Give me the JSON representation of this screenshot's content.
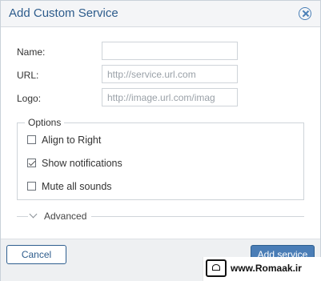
{
  "dialog": {
    "title": "Add Custom Service",
    "close_icon": "close-circle-icon"
  },
  "form": {
    "name_label": "Name:",
    "name_value": "",
    "name_placeholder": "",
    "url_label": "URL:",
    "url_value": "",
    "url_placeholder": "http://service.url.com",
    "logo_label": "Logo:",
    "logo_value": "",
    "logo_placeholder": "http://image.url.com/imag"
  },
  "options": {
    "legend": "Options",
    "items": [
      {
        "label": "Align to Right",
        "checked": false
      },
      {
        "label": "Show notifications",
        "checked": true
      },
      {
        "label": "Mute all sounds",
        "checked": false
      }
    ]
  },
  "advanced": {
    "label": "Advanced",
    "icon": "chevron-down-icon"
  },
  "footer": {
    "cancel_label": "Cancel",
    "add_label": "Add service"
  },
  "watermark": {
    "text": "www.Romaak.ir"
  },
  "colors": {
    "accent": "#4a7db6",
    "title": "#2d5c8c",
    "footer_bg": "#eef0f2"
  }
}
